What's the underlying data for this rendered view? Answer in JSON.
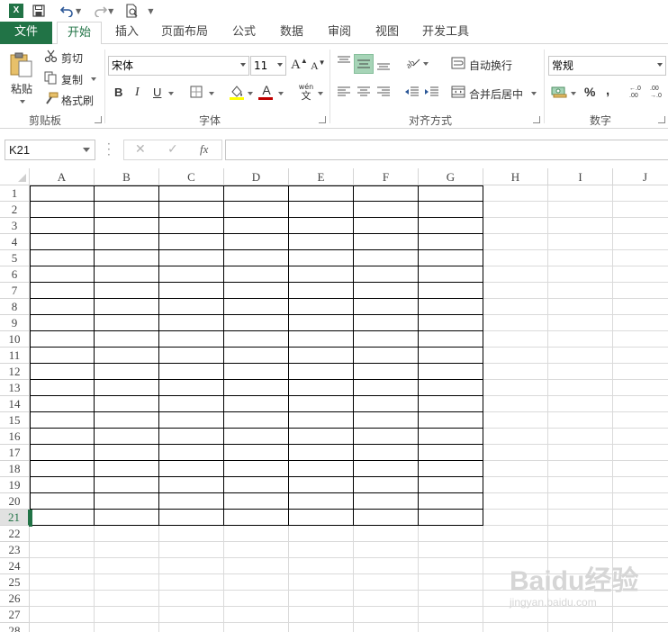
{
  "qat": {
    "logo_text": "X",
    "icons": [
      "excel-logo-icon",
      "save-icon",
      "undo-icon",
      "redo-icon",
      "print-preview-icon",
      "customize-dropdown-icon"
    ]
  },
  "tabs": [
    {
      "label": "文件",
      "key": "file"
    },
    {
      "label": "开始",
      "key": "home",
      "active": true
    },
    {
      "label": "插入",
      "key": "insert"
    },
    {
      "label": "页面布局",
      "key": "page-layout"
    },
    {
      "label": "公式",
      "key": "formulas"
    },
    {
      "label": "数据",
      "key": "data"
    },
    {
      "label": "审阅",
      "key": "review"
    },
    {
      "label": "视图",
      "key": "view"
    },
    {
      "label": "开发工具",
      "key": "developer"
    }
  ],
  "ribbon": {
    "clipboard": {
      "label": "剪贴板",
      "paste": "粘贴",
      "cut": "剪切",
      "copy": "复制",
      "format_painter": "格式刷"
    },
    "font": {
      "label": "字体",
      "font_name": "宋体",
      "font_size": "11",
      "bold": "B",
      "italic": "I",
      "underline": "U",
      "phonetic_top": "wén",
      "phonetic_bottom": "文",
      "grow": "A",
      "shrink": "A",
      "font_color_letter": "A"
    },
    "alignment": {
      "label": "对齐方式",
      "wrap_text": "自动换行",
      "merge_center": "合并后居中"
    },
    "number": {
      "label": "数字",
      "format": "常规",
      "percent": "%",
      "comma": ",",
      "inc_decimal": "←.0 .00",
      "dec_decimal": ".00 →.0"
    }
  },
  "formula_bar": {
    "name_box": "K21",
    "cancel": "✕",
    "enter": "✓",
    "fx": "fx",
    "value": ""
  },
  "grid": {
    "columns": [
      "A",
      "B",
      "C",
      "D",
      "E",
      "F",
      "G",
      "H",
      "I",
      "J"
    ],
    "rows": [
      "1",
      "2",
      "3",
      "4",
      "5",
      "6",
      "7",
      "8",
      "9",
      "10",
      "11",
      "12",
      "13",
      "14",
      "15",
      "16",
      "17",
      "18",
      "19",
      "20",
      "21",
      "22",
      "23",
      "24",
      "25",
      "26",
      "27",
      "28"
    ],
    "active_row": "21",
    "bordered_rows": 21,
    "bordered_cols": 7
  },
  "watermark": {
    "main": "Baidu经验",
    "sub": "jingyan.baidu.com"
  },
  "colors": {
    "accent": "#217346",
    "selected_button": "#a6d4b7",
    "font_color_bar": "#c00000",
    "fill_color_bar": "#ffff00"
  }
}
